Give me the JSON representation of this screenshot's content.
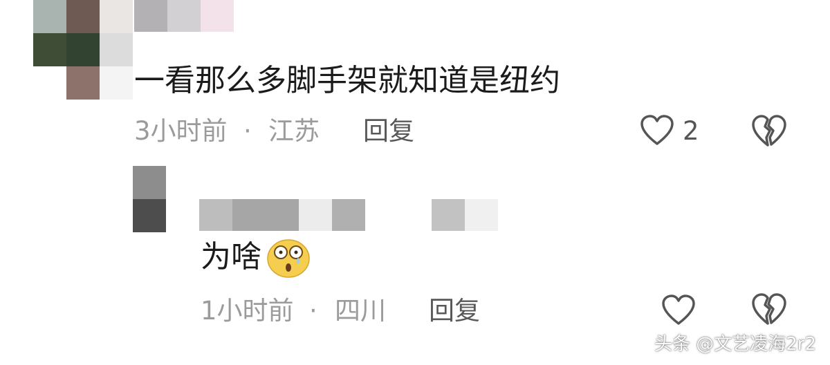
{
  "comments": [
    {
      "text": "一看那么多脚手架就知道是纽约",
      "time": "3小时前",
      "separator": "·",
      "location": "江苏",
      "reply_label": "回复",
      "like_count": "2"
    },
    {
      "text": "为啥",
      "emoji": "scared-face-emoji",
      "time": "1小时前",
      "separator": "·",
      "location": "四川",
      "reply_label": "回复"
    }
  ],
  "watermark": "头条 @文艺凌海2r2",
  "colors": {
    "meta_gray": "#9b9b9b",
    "text": "#1b1b1b",
    "icon_gray": "#555555"
  }
}
